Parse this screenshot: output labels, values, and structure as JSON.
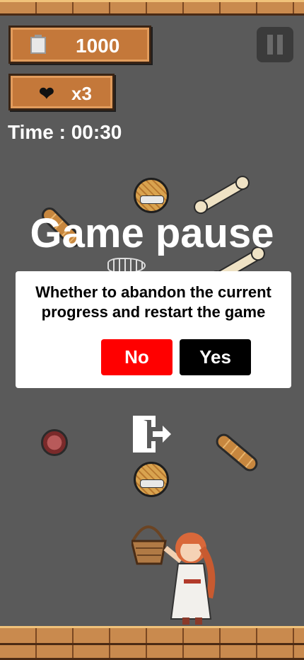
{
  "hud": {
    "score": "1000",
    "lives": "x3",
    "time": "Time : 00:30"
  },
  "overlay": {
    "title": "Game pause",
    "message": "Whether to abandon the current progress and restart the game",
    "no_label": "No",
    "yes_label": "Yes"
  },
  "icons": {
    "score": "clipboard-icon",
    "lives": "heart-icon",
    "pause": "pause-icon",
    "exit": "exit-door-icon"
  },
  "colors": {
    "background": "#5a5a5a",
    "no_button": "#ff0000",
    "yes_button": "#000000",
    "plank": "#c4783a"
  }
}
